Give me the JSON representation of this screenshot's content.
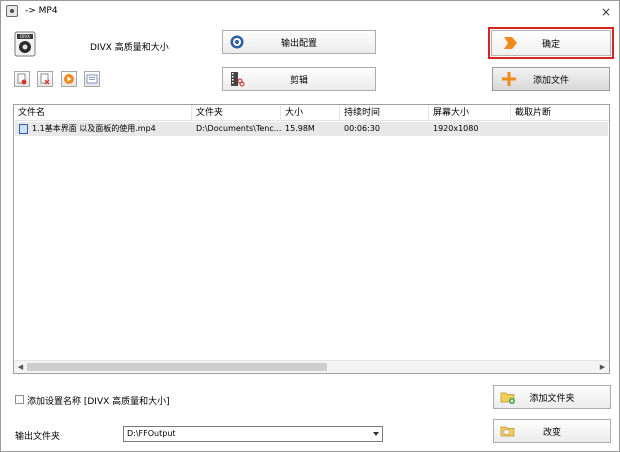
{
  "window": {
    "title": "-> MP4",
    "close_symbol": "×"
  },
  "profile": {
    "label": "DIVX 高质量和大小"
  },
  "buttons": {
    "output_config": "输出配置",
    "ok": "确定",
    "clip": "剪辑",
    "add_file": "添加文件",
    "add_folder": "添加文件夹",
    "change": "改变"
  },
  "toolbar_icons": [
    "remove-icon",
    "clear-icon",
    "play-icon",
    "info-icon"
  ],
  "file_list": {
    "columns": [
      "文件名",
      "文件夹",
      "大小",
      "持续时间",
      "屏幕大小",
      "截取片断"
    ],
    "rows": [
      {
        "name": "1.1基本界面 以及面板的使用.mp4",
        "folder": "D:\\Documents\\Tenc...",
        "size": "15.98M",
        "duration": "00:06:30",
        "resolution": "1920x1080",
        "clip": ""
      }
    ]
  },
  "options": {
    "add_setting_name_label": "添加设置名称 [DIVX 高质量和大小]",
    "add_setting_name_checked": false
  },
  "output": {
    "label": "输出文件夹",
    "folder": "D:\\FFOutput"
  },
  "colors": {
    "highlight_frame": "#d9231f",
    "accent_orange": "#f08a1c"
  }
}
